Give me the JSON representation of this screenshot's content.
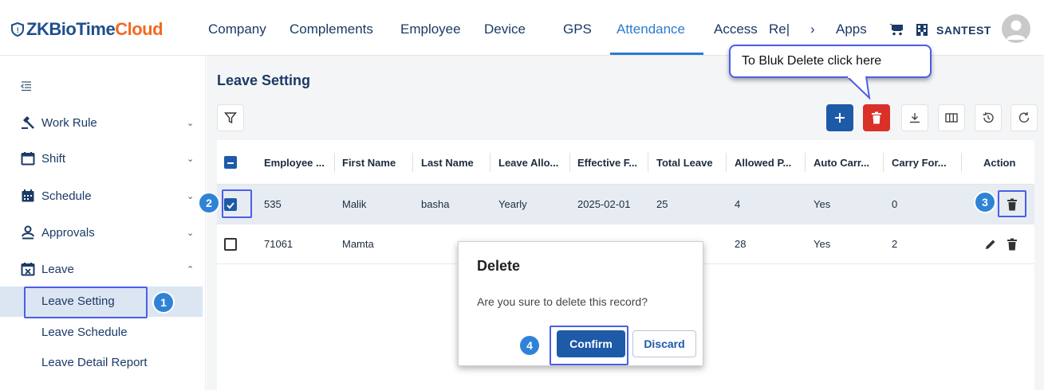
{
  "app": {
    "logo_part1": "ZKBioTime",
    "logo_part2": "Cloud",
    "brand_color": "#1f4e8c",
    "accent_color": "#f26a21"
  },
  "nav": {
    "items": [
      "Company",
      "Complements",
      "Employee",
      "Device",
      "GPS",
      "Attendance",
      "Access",
      "Re|",
      "Apps"
    ],
    "active": "Attendance",
    "overflow_glyph": "›",
    "user": "SANTEST"
  },
  "sidebar": {
    "items": [
      {
        "label": "Work Rule",
        "icon": "gavel-icon",
        "expanded": false
      },
      {
        "label": "Shift",
        "icon": "calendar-blank-icon",
        "expanded": false
      },
      {
        "label": "Schedule",
        "icon": "calendar-grid-icon",
        "expanded": false
      },
      {
        "label": "Approvals",
        "icon": "person-approval-icon",
        "expanded": false
      },
      {
        "label": "Leave",
        "icon": "calendar-x-icon",
        "expanded": true
      }
    ],
    "leave_sub": [
      "Leave Setting",
      "Leave Schedule",
      "Leave Detail Report"
    ],
    "selected": "Leave Setting"
  },
  "page": {
    "title": "Leave Setting"
  },
  "toolbar": {
    "icons": [
      "filter-icon",
      "add-icon",
      "delete-icon",
      "download-icon",
      "columns-icon",
      "history-icon",
      "refresh-icon"
    ]
  },
  "table": {
    "columns": [
      "Employee ...",
      "First Name",
      "Last Name",
      "Leave Allo...",
      "Effective F...",
      "Total Leave",
      "Allowed P...",
      "Auto Carr...",
      "Carry For...",
      "Action"
    ],
    "rows": [
      {
        "selected": true,
        "cells": [
          "535",
          "Malik",
          "basha",
          "Yearly",
          "2025-02-01",
          "25",
          "4",
          "Yes",
          "0"
        ]
      },
      {
        "selected": false,
        "cells": [
          "71061",
          "Mamta",
          "",
          "",
          "",
          "",
          "28",
          "Yes",
          "2"
        ]
      }
    ]
  },
  "tooltip": {
    "text": "To Bluk Delete click here"
  },
  "dialog": {
    "title": "Delete",
    "message": "Are you sure to delete this record?",
    "confirm": "Confirm",
    "discard": "Discard"
  },
  "steps": [
    "1",
    "2",
    "3",
    "4"
  ]
}
